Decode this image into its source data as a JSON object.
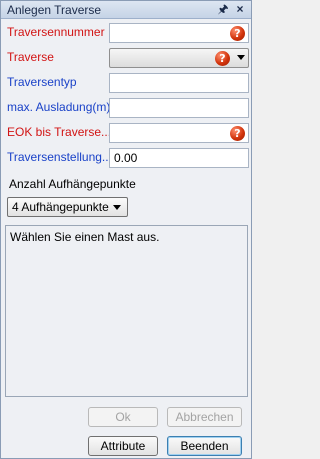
{
  "window": {
    "title": "Anlegen Traverse",
    "pin_glyph": "🖈",
    "close_glyph": "×"
  },
  "fields": [
    {
      "label": "Traversennummer",
      "value": "",
      "required": true,
      "has_error": true,
      "type": "text"
    },
    {
      "label": "Traverse",
      "value": "",
      "required": true,
      "has_error": true,
      "type": "combo"
    },
    {
      "label": "Traversentyp",
      "value": "",
      "required": false,
      "has_error": false,
      "type": "text"
    },
    {
      "label": "max. Ausladung(m)",
      "value": "",
      "required": false,
      "has_error": false,
      "type": "text"
    },
    {
      "label": "EOK bis Traverse...",
      "value": "",
      "required": true,
      "has_error": true,
      "type": "text"
    },
    {
      "label": "Traversenstellung...",
      "value": "0.00",
      "required": false,
      "has_error": false,
      "type": "text"
    }
  ],
  "error_glyph": "?",
  "aufhaengepunkte": {
    "label": "Anzahl Aufhängepunkte",
    "selected": "4 Aufhängepunkte"
  },
  "message": "Wählen Sie einen Mast aus.",
  "buttons": {
    "ok": "Ok",
    "abbrechen": "Abbrechen",
    "attribute": "Attribute",
    "beenden": "Beenden"
  },
  "colors": {
    "required_label": "#d21414",
    "optional_label": "#1a42c8",
    "error_icon": "#d2340c"
  }
}
